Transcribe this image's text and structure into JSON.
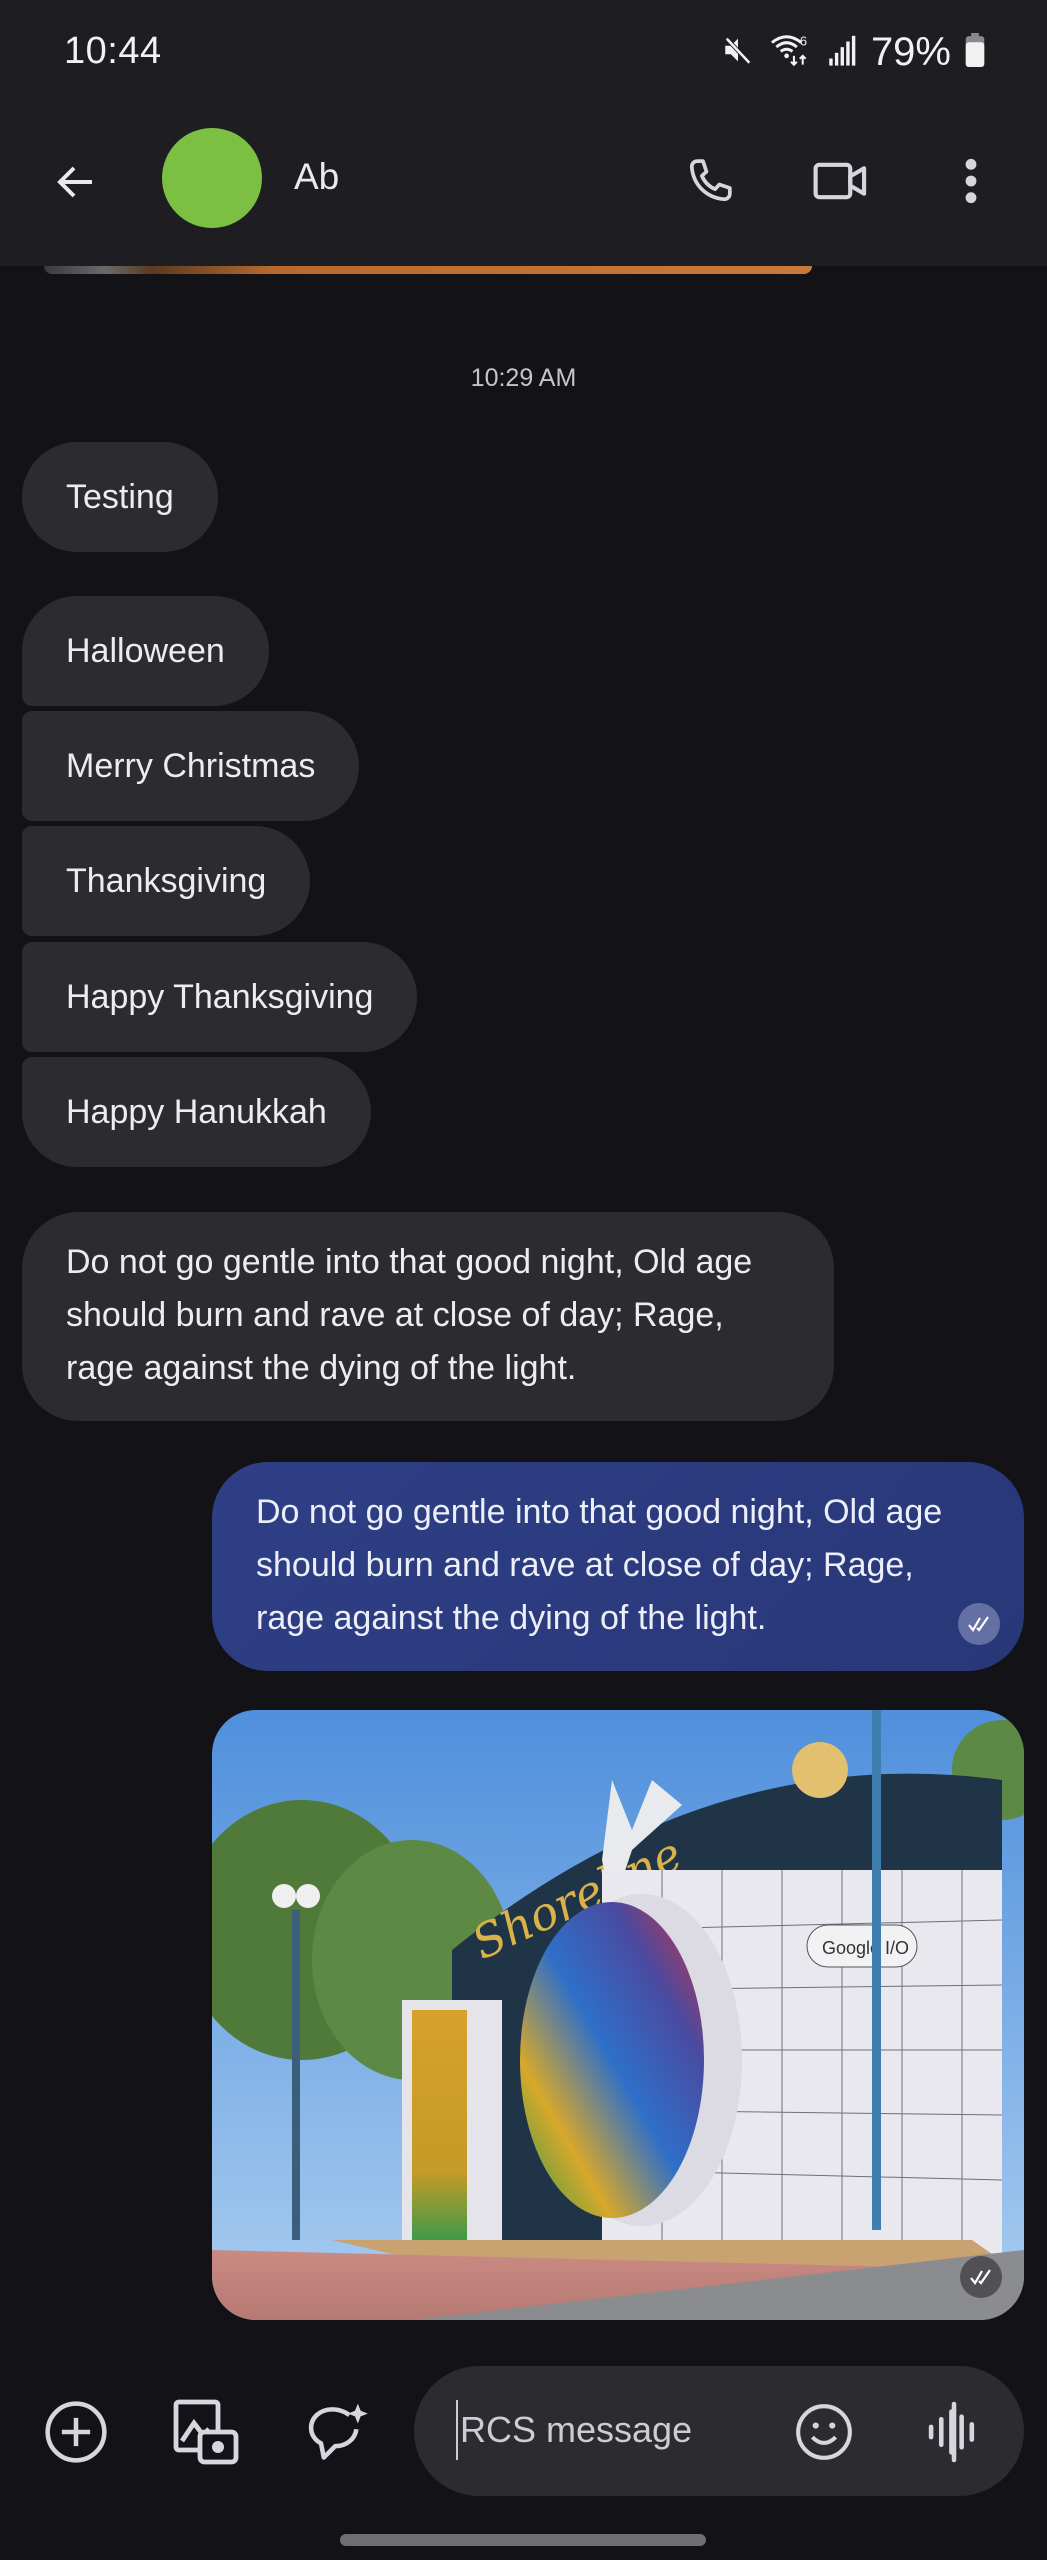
{
  "status_bar": {
    "time": "10:44",
    "battery_percent": "79%",
    "icons": [
      "mute-icon",
      "wifi-6-icon",
      "signal-icon",
      "battery-icon"
    ]
  },
  "header": {
    "contact_name": "Ab",
    "avatar_color": "#7bc043",
    "actions": [
      "back-arrow-icon",
      "phone-icon",
      "video-call-icon",
      "more-vert-icon"
    ]
  },
  "conversation": {
    "timestamp": "10:29 AM",
    "incoming_single": {
      "text": "Testing"
    },
    "incoming_group": [
      {
        "text": "Halloween"
      },
      {
        "text": "Merry Christmas"
      },
      {
        "text": "Thanksgiving"
      },
      {
        "text": "Happy Thanksgiving"
      },
      {
        "text": "Happy Hanukkah"
      }
    ],
    "incoming_long": {
      "lines": [
        "Do not go gentle into that good night, Old age",
        "should burn and rave at close of day; Rage,",
        "rage against the dying of the light."
      ]
    },
    "outgoing_long": {
      "lines": [
        "Do not go gentle into that good night, Old age",
        "should burn and rave at close of day; Rage,",
        "rage against the dying of the light."
      ],
      "status": "read"
    },
    "outgoing_photo": {
      "description": "Shoreline Amphitheatre stage with colorful Google I/O circle sculpture",
      "sign_text": "Shoreline",
      "badge_text": "Google I/O",
      "status": "read"
    }
  },
  "composer": {
    "placeholder": "RCS message",
    "value": "",
    "buttons": [
      "add-icon",
      "gallery-camera-icon",
      "ai-suggest-icon",
      "emoji-icon",
      "voice-message-icon"
    ]
  },
  "colors": {
    "background": "#121217",
    "bar": "#1e1e22",
    "incoming_bubble": "#2b2b30",
    "outgoing_bubble": "#2c3b80"
  }
}
